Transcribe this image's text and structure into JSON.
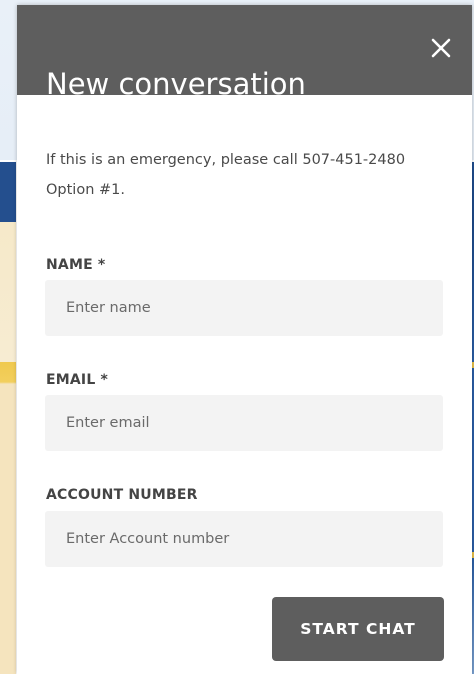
{
  "dialog": {
    "title": "New conversation",
    "notice": "If this is an emergency, please call 507-451-2480 Option #1."
  },
  "form": {
    "name": {
      "label": "NAME *",
      "placeholder": "Enter name",
      "value": ""
    },
    "email": {
      "label": "EMAIL *",
      "placeholder": "Enter email",
      "value": ""
    },
    "account": {
      "label": "ACCOUNT NUMBER",
      "placeholder": "Enter Account number",
      "value": ""
    },
    "submit_label": "START CHAT"
  },
  "icons": {
    "close": "close-icon"
  },
  "colors": {
    "header": "#5e5e5e",
    "button": "#5e5e5e",
    "input_bg": "#f3f3f3",
    "text": "#4a4a4a"
  }
}
